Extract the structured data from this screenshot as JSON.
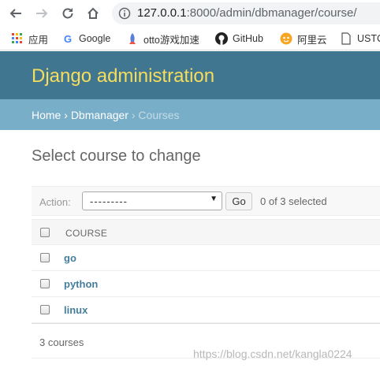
{
  "browser": {
    "url_host": "127.0.0.1",
    "url_path": ":8000/admin/dbmanager/course/",
    "bookmarks": [
      {
        "label": "应用",
        "icon": "apps-grid-icon"
      },
      {
        "label": "Google",
        "icon": "google-icon"
      },
      {
        "label": "otto游戏加速",
        "icon": "rocket-icon"
      },
      {
        "label": "GitHub",
        "icon": "github-icon"
      },
      {
        "label": "阿里云",
        "icon": "aliyun-icon"
      },
      {
        "label": "USTC",
        "icon": "page-icon"
      }
    ]
  },
  "header": {
    "brand": "Django administration"
  },
  "breadcrumbs": {
    "home": "Home",
    "sep1": "›",
    "app": "Dbmanager",
    "sep2": "›",
    "current": "Courses"
  },
  "main": {
    "title": "Select course to change"
  },
  "actions": {
    "label": "Action:",
    "selected_value": "---------",
    "go_label": "Go",
    "selected_count": "0 of 3 selected"
  },
  "table": {
    "column_header": "COURSE",
    "rows": [
      "go",
      "python",
      "linux"
    ]
  },
  "paginator": {
    "text": "3 courses"
  },
  "watermark": "https://blog.csdn.net/kangla0224",
  "colors": {
    "header_bg": "#417690",
    "brand": "#f5dd5d",
    "breadcrumbs_bg": "#79aec8",
    "link": "#447e9b"
  }
}
